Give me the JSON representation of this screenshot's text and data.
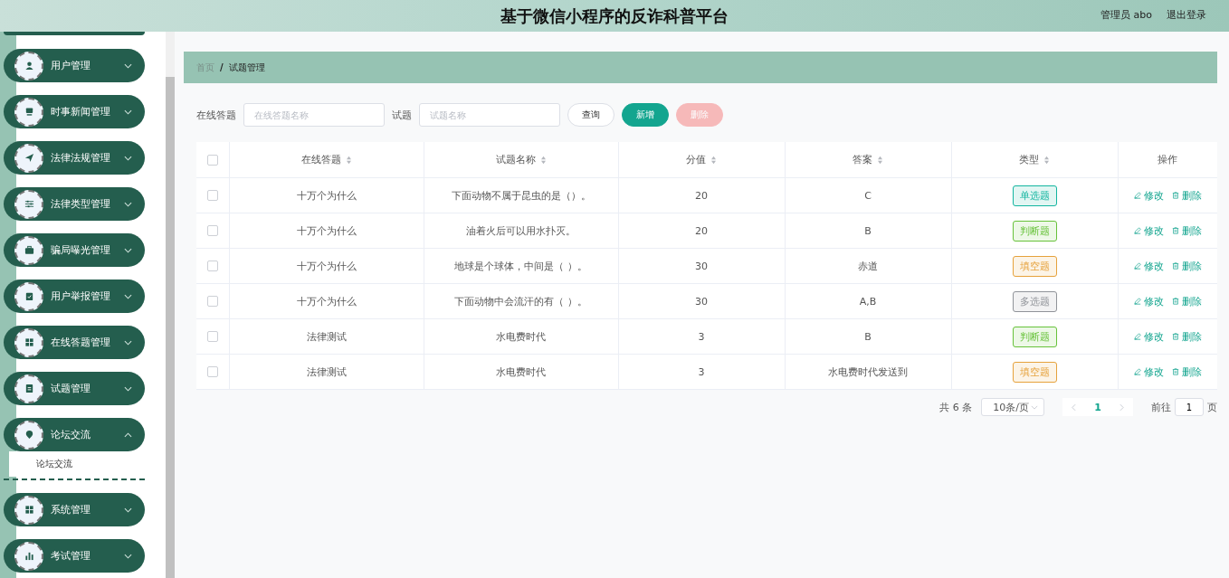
{
  "header": {
    "title": "基于微信小程序的反诈科普平台",
    "user": "管理员 abo",
    "logout": "退出登录"
  },
  "sidebar": {
    "items": [
      {
        "label": "用户管理",
        "expanded": false
      },
      {
        "label": "时事新闻管理",
        "expanded": false
      },
      {
        "label": "法律法规管理",
        "expanded": false
      },
      {
        "label": "法律类型管理",
        "expanded": false
      },
      {
        "label": "骗局曝光管理",
        "expanded": false
      },
      {
        "label": "用户举报管理",
        "expanded": false
      },
      {
        "label": "在线答题管理",
        "expanded": false
      },
      {
        "label": "试题管理",
        "expanded": false
      },
      {
        "label": "论坛交流",
        "expanded": true,
        "children": [
          {
            "label": "论坛交流"
          }
        ]
      },
      {
        "label": "系统管理",
        "expanded": false
      },
      {
        "label": "考试管理",
        "expanded": false
      }
    ]
  },
  "breadcrumb": {
    "items": [
      "首页",
      "试题管理"
    ],
    "separator": "/"
  },
  "search": {
    "fields": [
      {
        "label": "在线答题",
        "placeholder": "在线答题名称"
      },
      {
        "label": "试题",
        "placeholder": "试题名称"
      }
    ],
    "buttons": [
      {
        "label": "查询",
        "kind": "plain"
      },
      {
        "label": "新增",
        "kind": "primary"
      },
      {
        "label": "删除",
        "kind": "danger",
        "disabled": true
      }
    ]
  },
  "table": {
    "columns": [
      {
        "label": "在线答题",
        "sortable": true
      },
      {
        "label": "试题名称",
        "sortable": true
      },
      {
        "label": "分值",
        "sortable": true
      },
      {
        "label": "答案",
        "sortable": true
      },
      {
        "label": "类型",
        "sortable": true
      },
      {
        "label": "操作",
        "sortable": false
      }
    ],
    "all_selected": false,
    "rows": [
      {
        "selected": false,
        "quiz": "十万个为什么",
        "question": "下面动物不属于昆虫的是（）。",
        "score": "20",
        "answer": "C",
        "type": "单选题",
        "color": "#13b5a0",
        "edit": "修改",
        "delete": "删除"
      },
      {
        "selected": false,
        "quiz": "十万个为什么",
        "question": "油着火后可以用水扑灭。",
        "score": "20",
        "answer": "B",
        "type": "判断题",
        "color": "#67c23a",
        "edit": "修改",
        "delete": "删除"
      },
      {
        "selected": false,
        "quiz": "十万个为什么",
        "question": "地球是个球体，中间是（ ）。",
        "score": "30",
        "answer": "赤道",
        "type": "填空题",
        "color": "#e6a23c",
        "edit": "修改",
        "delete": "删除"
      },
      {
        "selected": false,
        "quiz": "十万个为什么",
        "question": "下面动物中会流汗的有（ ）。",
        "score": "30",
        "answer": "A,B",
        "type": "多选题",
        "color": "#909399",
        "edit": "修改",
        "delete": "删除"
      },
      {
        "selected": false,
        "quiz": "法律测试",
        "question": "水电费时代",
        "score": "3",
        "answer": "B",
        "type": "判断题",
        "color": "#67c23a",
        "edit": "修改",
        "delete": "删除"
      },
      {
        "selected": false,
        "quiz": "法律测试",
        "question": "水电费时代",
        "score": "3",
        "answer": "水电费时代发送到",
        "type": "填空题",
        "color": "#e6a23c",
        "edit": "修改",
        "delete": "删除"
      }
    ]
  },
  "pagination": {
    "total": "共 6 条",
    "page_size": "10条/页",
    "pages": [
      {
        "label": "1",
        "selected": true
      }
    ],
    "goto_label": "前往",
    "goto_value": "1",
    "goto_suffix": "页"
  }
}
